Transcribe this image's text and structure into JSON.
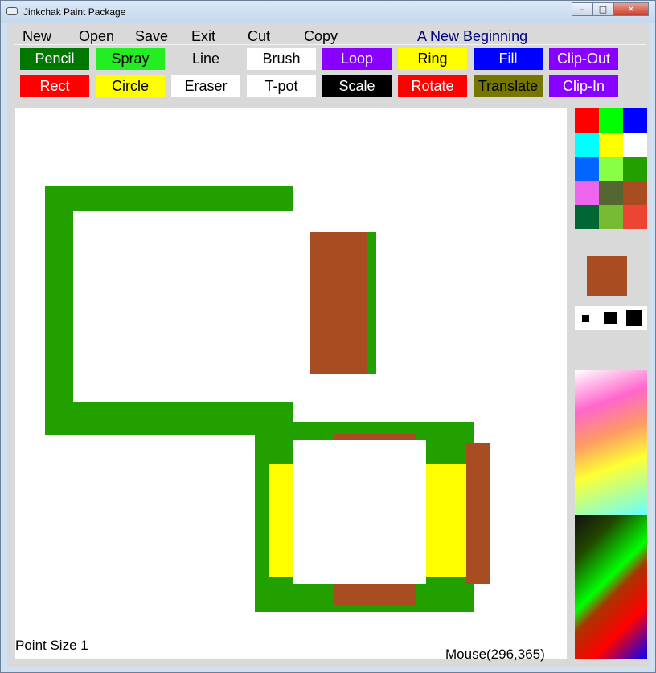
{
  "window": {
    "title": "Jinkchak Paint Package",
    "minimize": "–",
    "maximize": "□",
    "close": "✕"
  },
  "menu": {
    "items": [
      "New",
      "Open",
      "Save",
      "Exit",
      "Cut",
      "Copy"
    ],
    "title": "A New Beginning"
  },
  "tools": [
    {
      "label": "Pencil",
      "bg": "#007700",
      "fg": "#ffffff"
    },
    {
      "label": "Spray",
      "bg": "#22ee22",
      "fg": "#000000"
    },
    {
      "label": "Line",
      "bg": "#d9d9d9",
      "fg": "#000000"
    },
    {
      "label": "Brush",
      "bg": "#ffffff",
      "fg": "#000000"
    },
    {
      "label": "Loop",
      "bg": "#8800ff",
      "fg": "#ffffff"
    },
    {
      "label": "Ring",
      "bg": "#ffff00",
      "fg": "#000000"
    },
    {
      "label": "Fill",
      "bg": "#0000ff",
      "fg": "#ffffff"
    },
    {
      "label": "Clip-Out",
      "bg": "#8800ff",
      "fg": "#ffffff"
    },
    {
      "label": "Rect",
      "bg": "#ff0000",
      "fg": "#ffffff"
    },
    {
      "label": "Circle",
      "bg": "#ffff00",
      "fg": "#000000"
    },
    {
      "label": "Eraser",
      "bg": "#ffffff",
      "fg": "#000000"
    },
    {
      "label": "T-pot",
      "bg": "#ffffff",
      "fg": "#000000"
    },
    {
      "label": "Scale",
      "bg": "#000000",
      "fg": "#ffffff"
    },
    {
      "label": "Rotate",
      "bg": "#ff0000",
      "fg": "#ffffff"
    },
    {
      "label": "Translate",
      "bg": "#777700",
      "fg": "#000000"
    },
    {
      "label": "Clip-In",
      "bg": "#8800ff",
      "fg": "#ffffff"
    }
  ],
  "palette": [
    "#ff0000",
    "#00ff00",
    "#0000ff",
    "#00ffff",
    "#ffff00",
    "#ffffff",
    "#0066ff",
    "#88ff44",
    "#22a000",
    "#ee66ee",
    "#556633",
    "#a84c22",
    "#006633",
    "#77bb33",
    "#ee4433"
  ],
  "current_color": "#a84c22",
  "status": {
    "point_size": "Point Size 1",
    "mouse": "Mouse(296,365)"
  },
  "colors": {
    "green": "#22a000",
    "brown": "#a84c22",
    "yellow": "#ffff00",
    "white": "#ffffff"
  }
}
